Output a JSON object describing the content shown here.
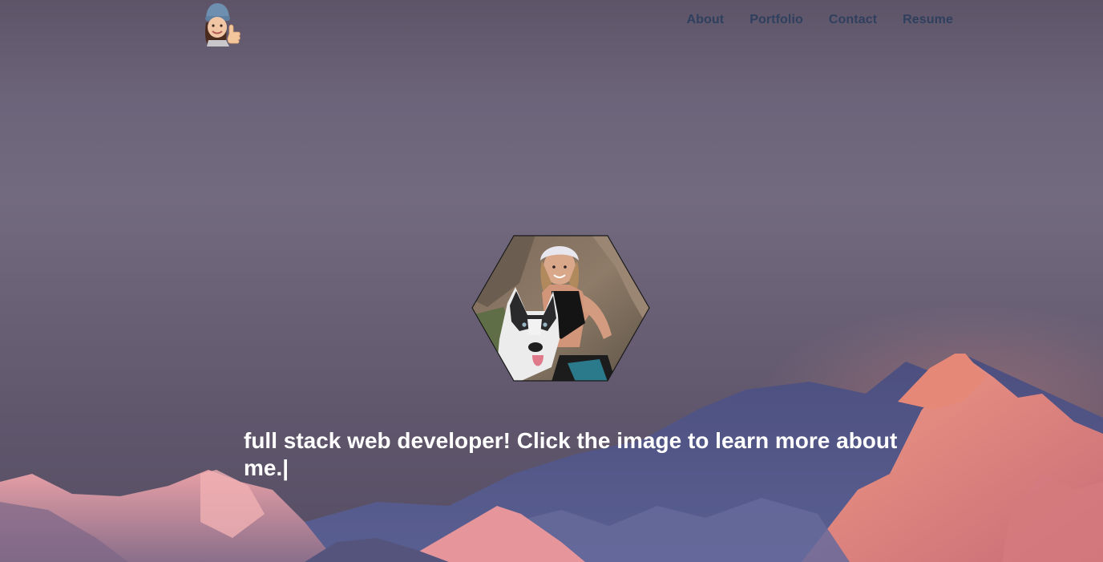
{
  "nav": {
    "logo_icon": "memoji-thumbs-up-icon",
    "links": [
      {
        "label": "About"
      },
      {
        "label": "Portfolio"
      },
      {
        "label": "Contact"
      },
      {
        "label": "Resume"
      }
    ]
  },
  "hero": {
    "profile_image_icon": "profile-photo-with-husky",
    "tagline": "full stack web developer! Click the image to learn more about me.",
    "cursor_char": "|"
  },
  "colors": {
    "nav_link": "#2f3f5e",
    "tagline": "#ffffff",
    "sky": "#6c6479",
    "alpenglow": "#e98a7c"
  }
}
